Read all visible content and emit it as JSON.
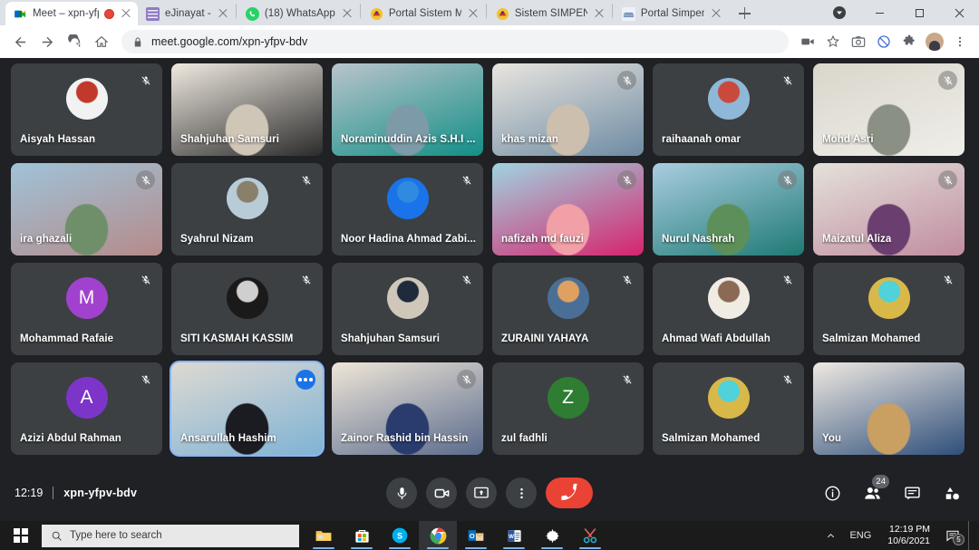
{
  "browser": {
    "tabs": [
      {
        "title": "Meet – xpn-yfpv-bdv",
        "favicon": "meet-icon",
        "active": true,
        "recording": true
      },
      {
        "title": "eJinayat -",
        "favicon": "ejinayat-icon",
        "active": false
      },
      {
        "title": "(18) WhatsApp",
        "favicon": "whatsapp-icon",
        "active": false
      },
      {
        "title": "Portal Sistem Maklumat",
        "favicon": "jata-icon",
        "active": false
      },
      {
        "title": "Sistem SIMPENI",
        "favicon": "jata-icon",
        "active": false
      },
      {
        "title": "Portal Simpeni",
        "favicon": "simpeni-icon",
        "active": false
      }
    ],
    "new_tab_label": "+",
    "url": "meet.google.com/xpn-yfpv-bdv",
    "toolbar_icons": [
      "back-icon",
      "forward-icon",
      "reload-icon",
      "home-icon",
      "lock-icon",
      "cast-icon",
      "bookmark-star-icon",
      "screenshot-camera-icon",
      "block-icon",
      "extensions-puzzle-icon",
      "profile-avatar-icon",
      "chrome-menu-icon"
    ],
    "window_controls": [
      "update-icon",
      "minimize-icon",
      "maximize-icon",
      "close-icon"
    ]
  },
  "meet": {
    "clock": "12:19",
    "meeting_code": "xpn-yfpv-bdv",
    "participant_count": "24",
    "controls": {
      "mic": "microphone-icon",
      "camera": "camera-icon",
      "present": "present-screen-icon",
      "more": "more-options-icon",
      "hangup": "end-call-icon"
    },
    "right_controls": {
      "info": "meeting-details-icon",
      "people": "people-icon",
      "chat": "chat-icon",
      "activities": "activities-icon"
    },
    "accent_blue": "#8ab4f8",
    "hangup_red": "#ea4335",
    "participants": [
      {
        "name": "Aisyah Hassan",
        "type": "avatar-photo",
        "muted": true,
        "avatar_colors": [
          "#f2f2f2",
          "#c0392b"
        ]
      },
      {
        "name": "Shahjuhan Samsuri",
        "type": "video",
        "muted": false,
        "video_colors": [
          "#efe9e0",
          "#cfc6b8",
          "#2b2b2b"
        ]
      },
      {
        "name": "Noraminuddin Azis S.H.I ...",
        "type": "video",
        "muted": false,
        "video_colors": [
          "#b9c4cc",
          "#7d9aa8",
          "#128f86"
        ]
      },
      {
        "name": "khas mizan",
        "type": "video",
        "muted": true,
        "video_colors": [
          "#e9e5df",
          "#cdbfae",
          "#6d8ba3"
        ]
      },
      {
        "name": "raihaanah omar",
        "type": "avatar-photo",
        "muted": true,
        "avatar_colors": [
          "#8fb8d8",
          "#c94a3c"
        ]
      },
      {
        "name": "Mohd Asri",
        "type": "video",
        "muted": true,
        "video_colors": [
          "#d9d6cb",
          "#8a9184",
          "#efeee9"
        ]
      },
      {
        "name": "ira ghazali",
        "type": "video",
        "muted": true,
        "video_colors": [
          "#9fc3d8",
          "#6f8f6a",
          "#b58b8b"
        ]
      },
      {
        "name": "Syahrul Nizam",
        "type": "avatar-photo",
        "muted": true,
        "avatar_colors": [
          "#b8ccd8",
          "#8a7f6a"
        ]
      },
      {
        "name": "Noor Hadina Ahmad Zabi...",
        "type": "avatar-photo",
        "muted": true,
        "avatar_colors": [
          "#1a73e8",
          "#2f8ae0"
        ]
      },
      {
        "name": "nafizah md fauzi",
        "type": "video",
        "muted": true,
        "video_colors": [
          "#9fd4e0",
          "#f2a0a8",
          "#d6246e"
        ]
      },
      {
        "name": "Nurul Nashrah",
        "type": "video",
        "muted": true,
        "video_colors": [
          "#a9cde0",
          "#5c8f5a",
          "#1f7a74"
        ]
      },
      {
        "name": "Maizatul Aliza",
        "type": "video",
        "muted": true,
        "video_colors": [
          "#e4e1da",
          "#6a3f70",
          "#c08da0"
        ]
      },
      {
        "name": "Mohammad Rafaie",
        "type": "initial",
        "initial": "M",
        "muted": true,
        "avatar_colors": [
          "#a142cf",
          "#a142cf"
        ]
      },
      {
        "name": "SITI KASMAH KASSIM",
        "type": "avatar-photo",
        "muted": true,
        "avatar_colors": [
          "#1a1a1a",
          "#cfcfcf"
        ]
      },
      {
        "name": "Shahjuhan Samsuri",
        "type": "avatar-photo",
        "muted": true,
        "avatar_colors": [
          "#cfc8ba",
          "#1f2a3c"
        ]
      },
      {
        "name": "ZURAINI YAHAYA",
        "type": "avatar-photo",
        "muted": true,
        "avatar_colors": [
          "#4a6f97",
          "#e0a060"
        ]
      },
      {
        "name": "Ahmad Wafi Abdullah",
        "type": "avatar-photo",
        "muted": true,
        "avatar_colors": [
          "#f0ece4",
          "#8a6a55"
        ]
      },
      {
        "name": "Salmizan Mohamed",
        "type": "avatar-photo",
        "muted": true,
        "avatar_colors": [
          "#d9b84a",
          "#4fd2d9"
        ]
      },
      {
        "name": "Azizi Abdul Rahman",
        "type": "initial",
        "initial": "A",
        "muted": true,
        "avatar_colors": [
          "#7d34c9",
          "#7d34c9"
        ]
      },
      {
        "name": "Ansarullah Hashim",
        "type": "video",
        "muted": false,
        "speaking": true,
        "video_colors": [
          "#ded9d2",
          "#1b1b22",
          "#7fb3d5"
        ]
      },
      {
        "name": "Zainor Rashid bin Hassin",
        "type": "video",
        "muted": true,
        "video_colors": [
          "#efe6d8",
          "#2a3b6e",
          "#5a6b8c"
        ]
      },
      {
        "name": "zul fadhli",
        "type": "initial",
        "initial": "Z",
        "muted": true,
        "avatar_colors": [
          "#2e7d32",
          "#2e7d32"
        ]
      },
      {
        "name": "Salmizan Mohamed",
        "type": "avatar-photo",
        "muted": true,
        "avatar_colors": [
          "#d9b84a",
          "#4fd2d9"
        ]
      },
      {
        "name": "You",
        "type": "video",
        "muted": false,
        "self": true,
        "video_colors": [
          "#efe9e2",
          "#c9a062",
          "#2f4f7a"
        ]
      }
    ]
  },
  "taskbar": {
    "start_label": "start-button",
    "search_placeholder": "Type here to search",
    "apps": [
      {
        "name": "file-explorer",
        "running": true
      },
      {
        "name": "microsoft-store",
        "running": true
      },
      {
        "name": "skype",
        "running": true
      },
      {
        "name": "google-chrome",
        "running": true,
        "active": true
      },
      {
        "name": "outlook",
        "running": true
      },
      {
        "name": "word",
        "running": true
      },
      {
        "name": "settings",
        "running": true
      },
      {
        "name": "snipping-tool",
        "running": true
      }
    ],
    "tray": {
      "language": "ENG",
      "time": "12:19 PM",
      "date": "10/6/2021",
      "notification_count": "5"
    }
  }
}
